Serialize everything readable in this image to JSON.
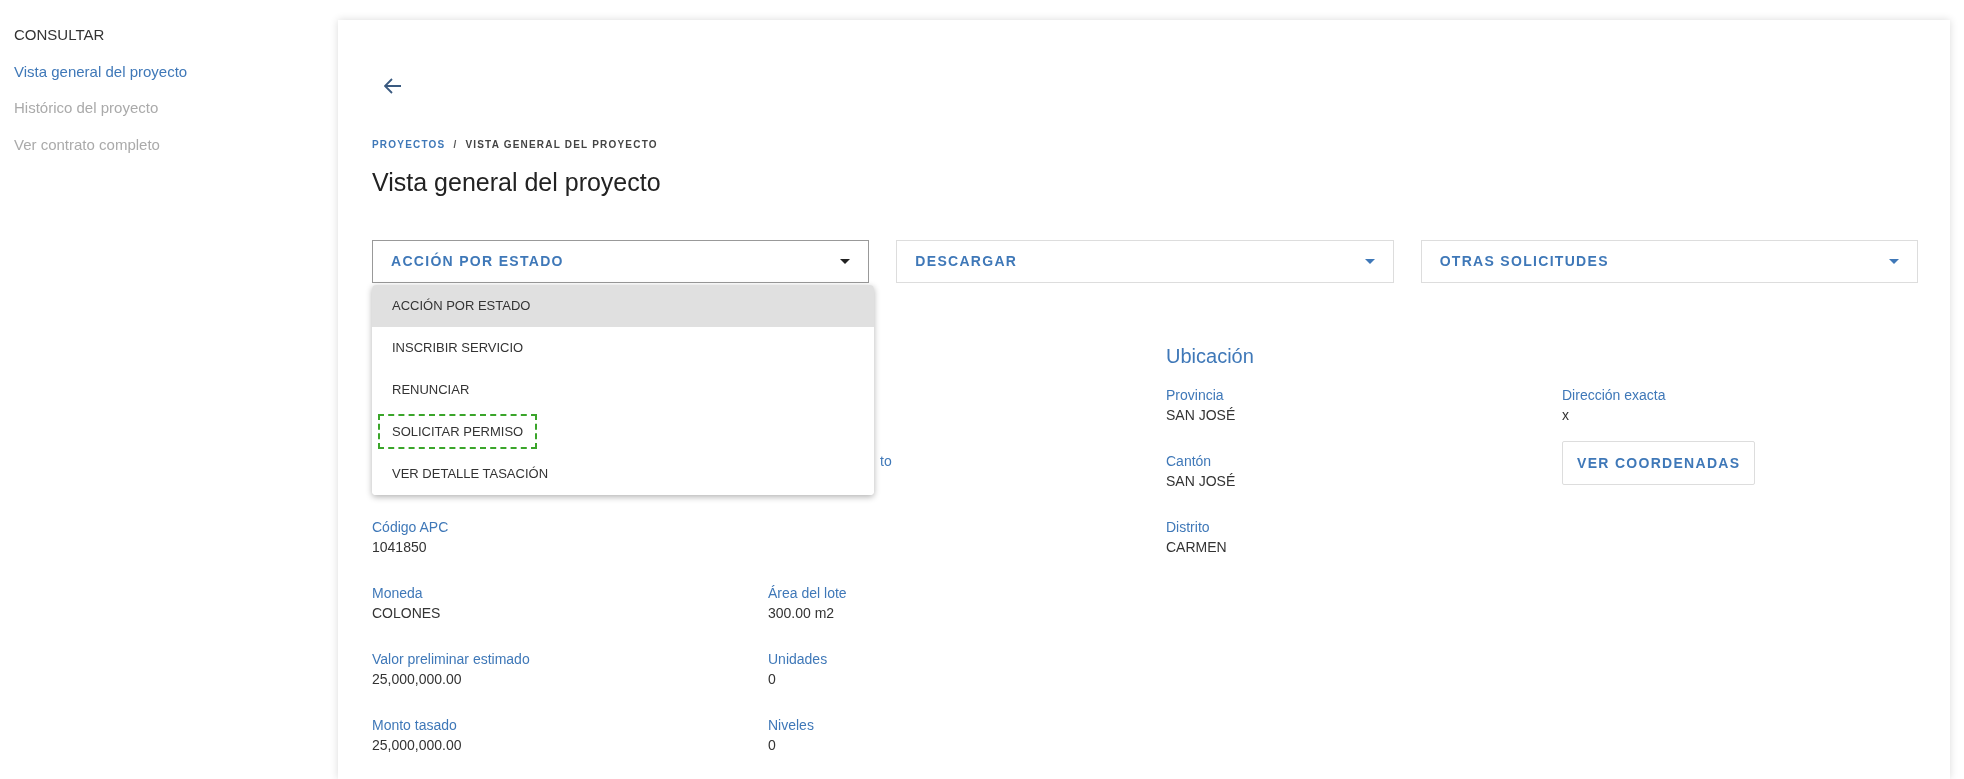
{
  "sidebar": {
    "heading": "CONSULTAR",
    "items": [
      {
        "label": "Vista general del proyecto",
        "selected": true
      },
      {
        "label": "Histórico del proyecto",
        "selected": false
      },
      {
        "label": "Ver contrato completo",
        "selected": false
      }
    ]
  },
  "breadcrumb": [
    {
      "label": "PROYECTOS",
      "link": true
    },
    {
      "label": "VISTA GENERAL DEL PROYECTO",
      "link": false
    }
  ],
  "separator": "/",
  "title": "Vista general del proyecto",
  "dropdowns": [
    {
      "label": "ACCIÓN POR ESTADO",
      "expanded": true
    },
    {
      "label": "DESCARGAR",
      "expanded": false
    },
    {
      "label": "OTRAS SOLICITUDES",
      "expanded": false
    }
  ],
  "menu": {
    "items": [
      {
        "label": "ACCIÓN POR ESTADO",
        "selected": true,
        "highlighted": false
      },
      {
        "label": "INSCRIBIR SERVICIO",
        "selected": false,
        "highlighted": false
      },
      {
        "label": "RENUNCIAR",
        "selected": false,
        "highlighted": false
      },
      {
        "label": "SOLICITAR PERMISO",
        "selected": false,
        "highlighted": true
      },
      {
        "label": "VER DETALLE TASACIÓN",
        "selected": false,
        "highlighted": false
      }
    ]
  },
  "details": {
    "covered_label_fragment": "to",
    "column_1": [
      {
        "label": "Código APC",
        "value": "1041850"
      },
      {
        "label": "Moneda",
        "value": "COLONES"
      },
      {
        "label": "Valor preliminar estimado",
        "value": "25,000,000.00"
      },
      {
        "label": "Monto tasado",
        "value": "25,000,000.00"
      }
    ],
    "column_2": [
      {
        "label": "Área del lote",
        "value": "300.00 m2"
      },
      {
        "label": "Unidades",
        "value": "0"
      },
      {
        "label": "Niveles",
        "value": "0"
      }
    ]
  },
  "location": {
    "heading": "Ubicación",
    "column_1": [
      {
        "label": "Provincia",
        "value": "SAN JOSÉ"
      },
      {
        "label": "Cantón",
        "value": "SAN JOSÉ"
      },
      {
        "label": "Distrito",
        "value": "CARMEN"
      }
    ],
    "column_2": [
      {
        "label": "Dirección exacta",
        "value": "x"
      }
    ],
    "button": "VER COORDENADAS"
  }
}
